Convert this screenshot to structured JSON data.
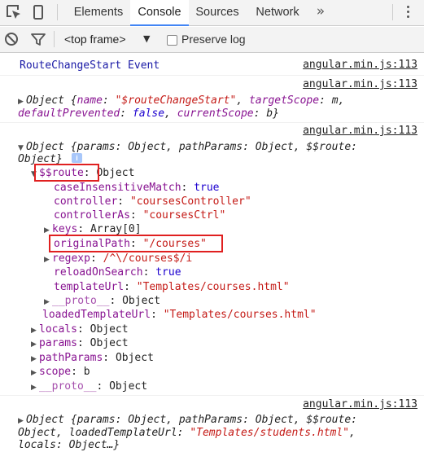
{
  "tabbar": {
    "tabs": [
      "Elements",
      "Console",
      "Sources",
      "Network"
    ],
    "active_tab": "Console",
    "more_label": "»"
  },
  "console_toolbar": {
    "frame_label": "<top frame>",
    "frame_arrow": "▼",
    "preserve_log_label": "Preserve log",
    "preserve_log_checked": false
  },
  "messages": {
    "m1": {
      "text": "RouteChangeStart Event",
      "source": "angular.min.js:113"
    },
    "m2": {
      "source": "angular.min.js:113",
      "line1_open": "Object {",
      "line1_k1": "name",
      "line1_v1": "\"$routeChangeStart\"",
      "line1_k2": "targetScope",
      "line1_v2": "m",
      "line2_k1": "defaultPrevented",
      "line2_v1": "false",
      "line2_k2": "currentScope",
      "line2_v2": "b}"
    },
    "m3": {
      "source": "angular.min.js:113",
      "header_line1": "Object {params: Object, pathParams: Object, $$route:",
      "header_line2": "Object}",
      "info_badge": "i",
      "route_key": "$$route",
      "route_val": "Object",
      "props": [
        {
          "key": "caseInsensitiveMatch",
          "value": "true",
          "kind": "kw"
        },
        {
          "key": "controller",
          "value": "\"coursesController\"",
          "kind": "str"
        },
        {
          "key": "controllerAs",
          "value": "\"coursesCtrl\"",
          "kind": "str"
        },
        {
          "key": "keys",
          "value": "Array[0]",
          "kind": "plain"
        },
        {
          "key": "originalPath",
          "value": "\"/courses\"",
          "kind": "str"
        },
        {
          "key": "regexp",
          "value": "/^\\/courses$/i",
          "kind": "str"
        },
        {
          "key": "reloadOnSearch",
          "value": "true",
          "kind": "kw"
        },
        {
          "key": "templateUrl",
          "value": "\"Templates/courses.html\"",
          "kind": "str"
        },
        {
          "key": "__proto__",
          "value": "Object",
          "kind": "plain"
        }
      ],
      "loaded_key": "loadedTemplateUrl",
      "loaded_val": "\"Templates/courses.html\"",
      "children": [
        {
          "key": "locals",
          "value": "Object"
        },
        {
          "key": "params",
          "value": "Object"
        },
        {
          "key": "pathParams",
          "value": "Object"
        },
        {
          "key": "scope",
          "value": "b"
        },
        {
          "key": "__proto__",
          "value": "Object"
        }
      ]
    },
    "m4": {
      "source": "angular.min.js:113",
      "line1": "Object {params: Object, pathParams: Object, $$route:",
      "line2_a": "Object, loadedTemplateUrl: ",
      "line2_b": "\"Templates/students.html\"",
      "line2_c": ",",
      "line3": "locals: Object…}"
    }
  },
  "colors": {
    "accent": "#4285f4",
    "highlight_box": "#e02020",
    "property_key": "#881391",
    "string_value": "#c41a16",
    "keyword_value": "#1c00cf",
    "event_text": "#1a1aa6"
  },
  "icons": {
    "inspect": "inspect-element-icon",
    "device": "device-toggle-icon",
    "clear": "clear-console-icon",
    "filter": "filter-icon",
    "more_tabs": "chevron-double-right-icon",
    "menu": "kebab-menu-icon"
  }
}
